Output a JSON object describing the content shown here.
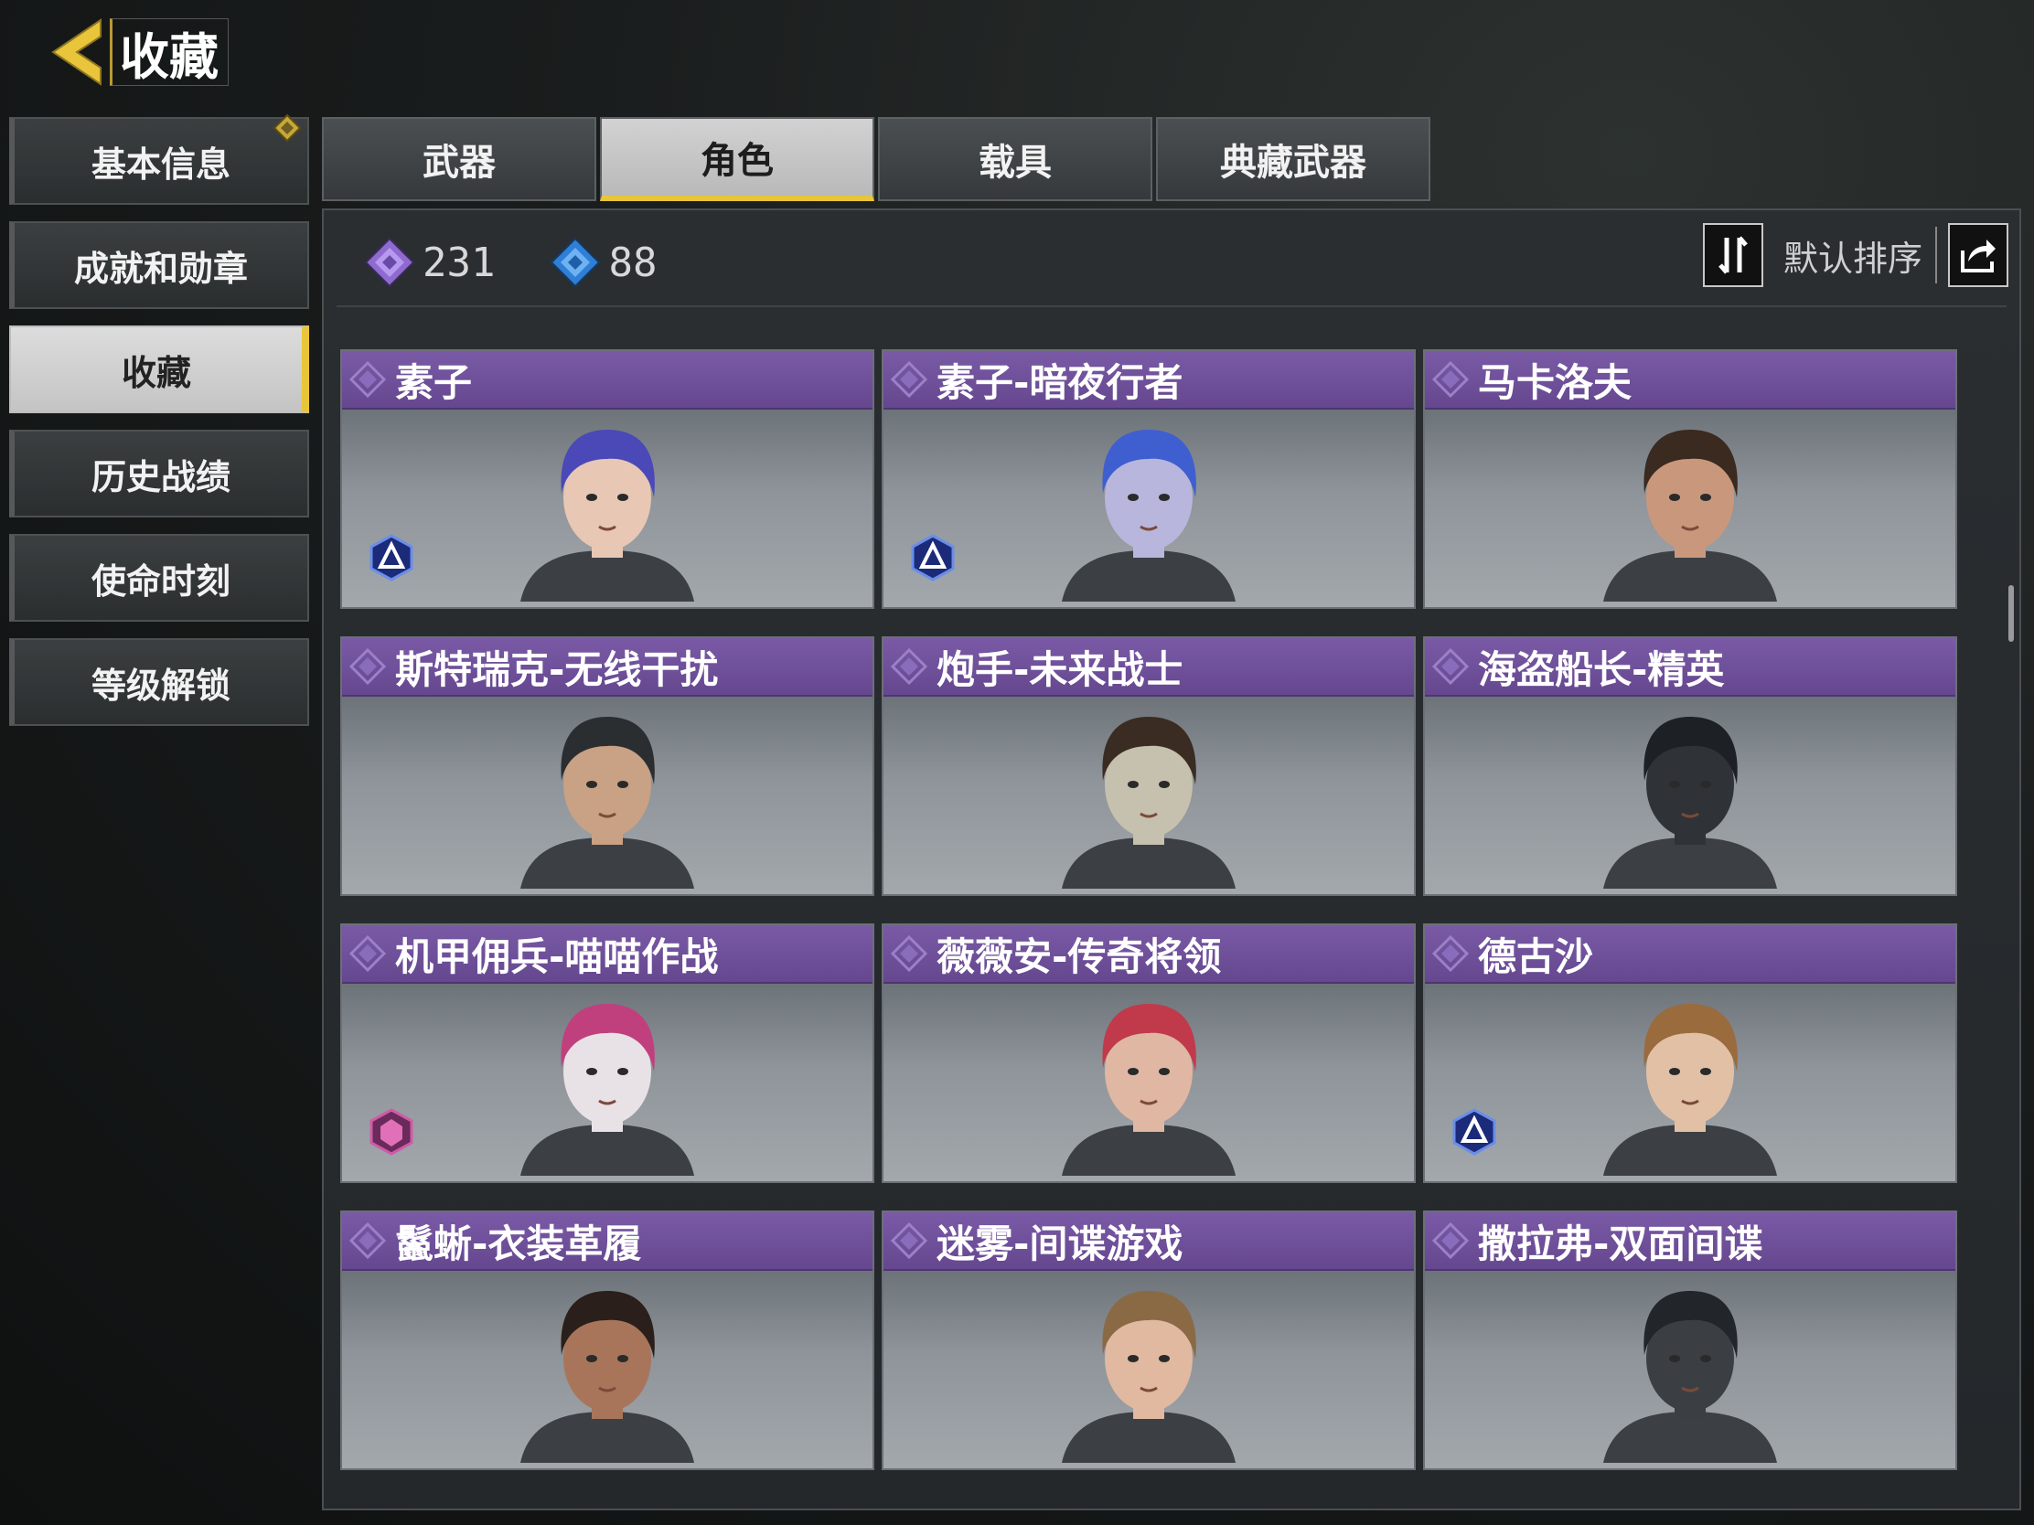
{
  "header": {
    "title": "收藏"
  },
  "sidebar": {
    "items": [
      {
        "label": "基本信息",
        "active": false,
        "badge": true
      },
      {
        "label": "成就和勋章",
        "active": false
      },
      {
        "label": "收藏",
        "active": true
      },
      {
        "label": "历史战绩",
        "active": false
      },
      {
        "label": "使命时刻",
        "active": false
      },
      {
        "label": "等级解锁",
        "active": false
      }
    ]
  },
  "tabs": [
    {
      "label": "武器",
      "active": false
    },
    {
      "label": "角色",
      "active": true
    },
    {
      "label": "载具",
      "active": false
    },
    {
      "label": "典藏武器",
      "active": false
    }
  ],
  "stats": {
    "purple_count": "231",
    "blue_count": "88"
  },
  "sort": {
    "label": "默认排序"
  },
  "cards": [
    {
      "name": "素子",
      "rank_icon": "blue-rank-icon",
      "hair": "#4b48b8",
      "skin": "#e8c7b4"
    },
    {
      "name": "素子-暗夜行者",
      "rank_icon": "blue-rank-icon",
      "hair": "#3f5fd1",
      "skin": "#b8b6dc"
    },
    {
      "name": "马卡洛夫",
      "rank_icon": "",
      "hair": "#3a2a20",
      "skin": "#c9987c"
    },
    {
      "name": "斯特瑞克-无线干扰",
      "rank_icon": "",
      "hair": "#2b2e31",
      "skin": "#c9a184"
    },
    {
      "name": "炮手-未来战士",
      "rank_icon": "",
      "hair": "#3a2c22",
      "skin": "#c6c1ae"
    },
    {
      "name": "海盗船长-精英",
      "rank_icon": "",
      "hair": "#1d2024",
      "skin": "#2f3338"
    },
    {
      "name": "机甲佣兵-喵喵作战",
      "rank_icon": "pink-rank-icon",
      "hair": "#c0407e",
      "skin": "#e8e2e6"
    },
    {
      "name": "薇薇安-传奇将领",
      "rank_icon": "",
      "hair": "#c03a4c",
      "skin": "#e0b7a2"
    },
    {
      "name": "德古沙",
      "rank_icon": "blue-rank-icon",
      "hair": "#9a6b3d",
      "skin": "#e2c0a6"
    },
    {
      "name": "鬣蜥-衣装革履",
      "rank_icon": "",
      "hair": "#2a1f1a",
      "skin": "#a8755a"
    },
    {
      "name": "迷雾-间谍游戏",
      "rank_icon": "",
      "hair": "#8a6a45",
      "skin": "#e0b9a0"
    },
    {
      "name": "撒拉弗-双面间谍",
      "rank_icon": "",
      "hair": "#222529",
      "skin": "#3b3f44"
    }
  ],
  "colors": {
    "accent": "#e8c53a",
    "card_header": "#6f4f9c"
  }
}
